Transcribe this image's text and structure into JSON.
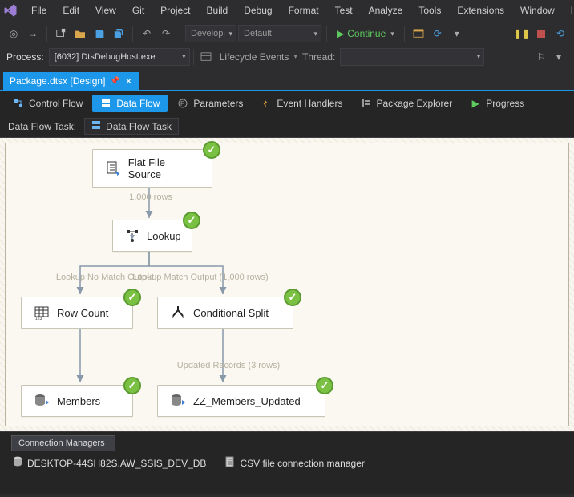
{
  "menu": [
    "File",
    "Edit",
    "View",
    "Git",
    "Project",
    "Build",
    "Debug",
    "Format",
    "Test",
    "Analyze",
    "Tools",
    "Extensions",
    "Window",
    "H"
  ],
  "toolbar": {
    "config_combo": "Developi",
    "platform_combo": "Default",
    "continue_label": "Continue"
  },
  "process": {
    "label": "Process:",
    "value": "[6032] DtsDebugHost.exe",
    "lifecycle_label": "Lifecycle Events",
    "thread_label": "Thread:"
  },
  "doc_tab": {
    "title": "Package.dtsx [Design]"
  },
  "designer_tabs": {
    "control_flow": "Control Flow",
    "data_flow": "Data Flow",
    "parameters": "Parameters",
    "event_handlers": "Event Handlers",
    "package_explorer": "Package Explorer",
    "progress": "Progress"
  },
  "dft": {
    "label": "Data Flow Task:",
    "value": "Data Flow Task"
  },
  "nodes": {
    "flat_file": "Flat File Source",
    "lookup": "Lookup",
    "row_count": "Row Count",
    "cond_split": "Conditional Split",
    "members": "Members",
    "zz_members": "ZZ_Members_Updated"
  },
  "edges": {
    "e1": "1,000 rows",
    "e2": "Lookup No Match Output",
    "e3": "Lookup Match Output (1,000 rows)",
    "e4": "Updated Records (3 rows)"
  },
  "conn": {
    "header": "Connection Managers",
    "db": "DESKTOP-44SH82S.AW_SSIS_DEV_DB",
    "csv": "CSV file connection manager"
  }
}
